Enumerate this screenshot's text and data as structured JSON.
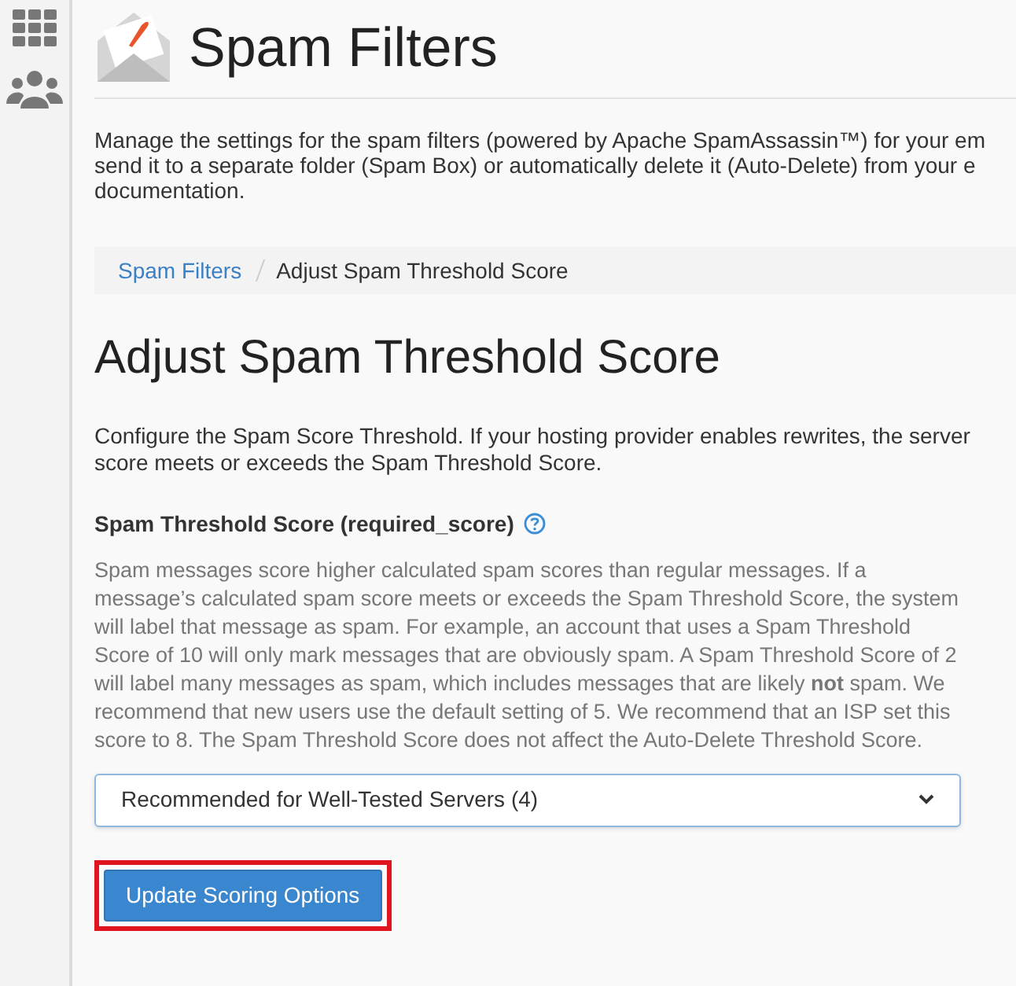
{
  "sidebar": {
    "items": [
      {
        "kind": "apps"
      },
      {
        "kind": "users"
      }
    ]
  },
  "page": {
    "title": "Spam Filters",
    "intro_lines": [
      "Manage the settings for the spam filters (powered by Apache SpamAssassin™) for your em",
      "send it to a separate folder (Spam Box) or automatically delete it (Auto-Delete) from your e",
      "documentation."
    ]
  },
  "breadcrumb": [
    {
      "label": "Spam Filters",
      "link": true
    },
    {
      "label": "Adjust Spam Threshold Score",
      "link": false
    }
  ],
  "section": {
    "heading": "Adjust Spam Threshold Score",
    "description_lines": [
      "Configure the Spam Score Threshold. If your hosting provider enables rewrites, the server",
      "score meets or exceeds the Spam Threshold Score."
    ],
    "field_label": "Spam Threshold Score (required_score)",
    "help_text": "Spam messages score higher calculated spam scores than regular messages. If a message’s calculated spam score meets or exceeds the Spam Threshold Score, the system will label that message as spam. For example, an account that uses a Spam Threshold Score of 10 will only mark messages that are obviously spam. A Spam Threshold Score of 2 will label many messages as spam, which includes messages that are likely **not** spam. We recommend that new users use the default setting of 5. We recommend that an ISP set this score to 8. The Spam Threshold Score does not affect the Auto-Delete Threshold Score.",
    "select_value": "Recommended for Well-Tested Servers (4)",
    "button": {
      "label": "Update Scoring Options",
      "highlighted": true
    }
  }
}
